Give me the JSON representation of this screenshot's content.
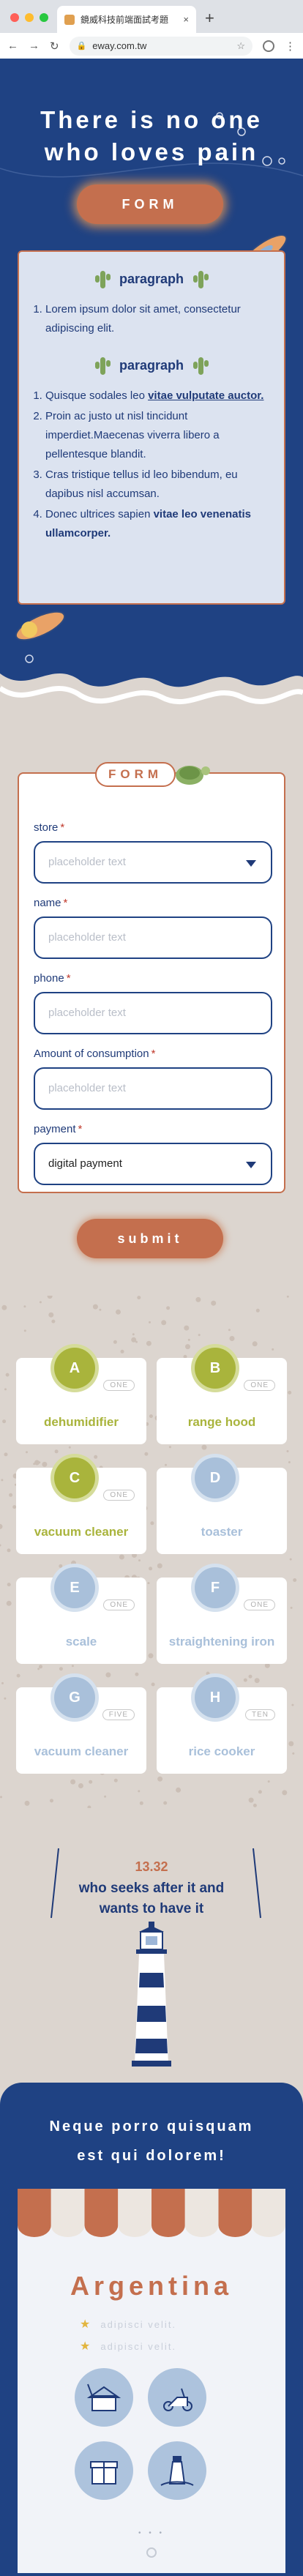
{
  "browser": {
    "tab_title": "鏡威科技前端面試考題",
    "tab_close": "×",
    "new_tab": "+",
    "url": "eway.com.tw",
    "nav_back": "←",
    "nav_forward": "→",
    "nav_reload": "↻",
    "bookmark_star": "☆",
    "menu": "⋮"
  },
  "hero": {
    "title_line1": "There is no one",
    "title_line2": "who loves pain",
    "button": "FORM",
    "paragraph_heading_1": "paragraph",
    "list1": [
      "Lorem ipsum dolor sit amet, consectetur adipiscing elit."
    ],
    "paragraph_heading_2": "paragraph",
    "list2": {
      "i1_text": "Quisque sodales leo ",
      "i1_link": "vitae vulputate auctor.",
      "i2": "Proin ac justo ut nisl tincidunt imperdiet.Maecenas viverra libero a pellentesque blandit.",
      "i3": "Cras tristique tellus id leo bibendum, eu dapibus nisl accumsan.",
      "i4_text": "Donec ultrices sapien ",
      "i4_bold": "vitae leo venenatis ullamcorper."
    }
  },
  "form": {
    "pill": "FORM",
    "store_label": "store",
    "store_placeholder": "placeholder text",
    "name_label": "name",
    "name_placeholder": "placeholder text",
    "phone_label": "phone",
    "phone_placeholder": "placeholder text",
    "amount_label": "Amount of consumption",
    "amount_placeholder": "placeholder text",
    "payment_label": "payment",
    "payment_value": "digital payment",
    "required_mark": "*",
    "submit": "submit"
  },
  "products": [
    {
      "letter": "A",
      "count": "ONE",
      "name": "dehumidifier",
      "active": true
    },
    {
      "letter": "B",
      "count": "ONE",
      "name": "range hood",
      "active": true
    },
    {
      "letter": "C",
      "count": "ONE",
      "name": "vacuum cleaner",
      "active": true
    },
    {
      "letter": "D",
      "count": "",
      "name": "toaster",
      "active": false
    },
    {
      "letter": "E",
      "count": "ONE",
      "name": "scale",
      "active": false
    },
    {
      "letter": "F",
      "count": "ONE",
      "name": "straightening iron",
      "active": false
    },
    {
      "letter": "G",
      "count": "FIVE",
      "name": "vacuum cleaner",
      "active": false
    },
    {
      "letter": "H",
      "count": "TEN",
      "name": "rice cooker",
      "active": false
    }
  ],
  "lighthouse": {
    "number": "13.32",
    "line1": "who seeks after it and",
    "line2": "wants to have it"
  },
  "bottom": {
    "title_line1": "Neque porro quisquam",
    "title_line2": "est qui dolorem!",
    "country": "Argentina",
    "star_text_1": "adipisci velit.",
    "star_text_2": "adipisci velit.",
    "pager": "• • •"
  },
  "colors": {
    "navy": "#1f4283",
    "terracotta": "#c46f4e",
    "olive_active": "#a9b43c",
    "muted_blue": "#a9c0da",
    "beige": "#dcd5cf"
  }
}
